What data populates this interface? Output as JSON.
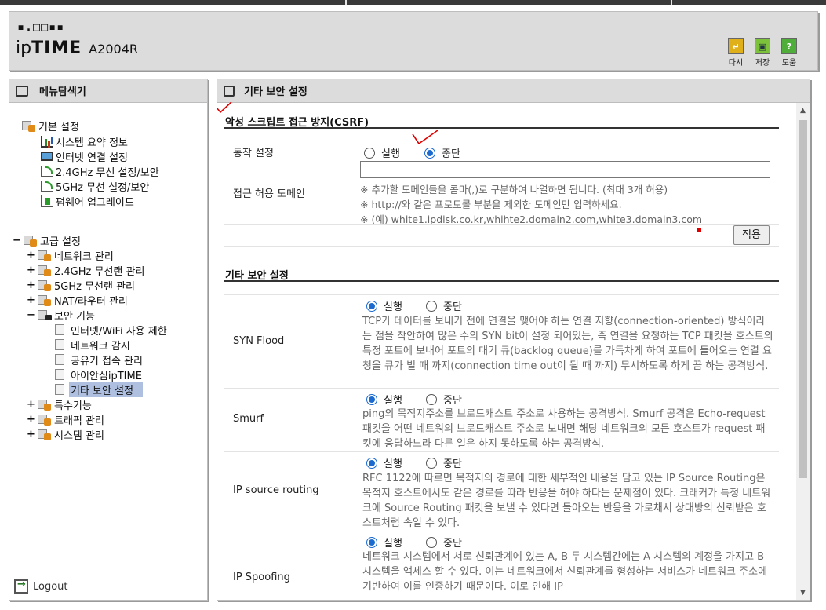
{
  "header": {
    "logo_dots": "▪.□□▪▪",
    "brand_ip": "ip",
    "brand_time": "TIME",
    "model": "A2004R",
    "buttons": [
      {
        "label": "다시",
        "icon": "undo-icon",
        "glyph": "↵"
      },
      {
        "label": "저장",
        "icon": "save-icon",
        "glyph": "▣"
      },
      {
        "label": "도움",
        "icon": "help-icon",
        "glyph": "?"
      }
    ]
  },
  "sidebar": {
    "title": "메뉴탐색기",
    "basic": {
      "label": "기본 설정",
      "items": [
        "시스템 요약 정보",
        "인터넷 연결 설정",
        "2.4GHz 무선 설정/보안",
        "5GHz 무선 설정/보안",
        "펌웨어 업그레이드"
      ]
    },
    "advanced": {
      "label": "고급 설정",
      "items": [
        "네트워크 관리",
        "2.4GHz 무선랜 관리",
        "5GHz 무선랜 관리",
        "NAT/라우터 관리",
        "보안 기능"
      ],
      "security_items": [
        "인터넷/WiFi 사용 제한",
        "네트워크 감시",
        "공유기 접속 관리",
        "아이안심ipTIME",
        "기타 보안 설정"
      ],
      "more_items": [
        "특수기능",
        "트래픽 관리",
        "시스템 관리"
      ]
    },
    "logout": "Logout"
  },
  "main": {
    "title": "기타 보안 설정",
    "csrf": {
      "title": "악성 스크립트 접근 방지(CSRF)",
      "action_label": "동작 설정",
      "run": "실행",
      "stop": "중단",
      "selected": "stop",
      "domain_label": "접근 허용 도메인",
      "domain_value": "",
      "notes": [
        "※ 추가할 도메인들을 콤마(,)로 구분하여 나열하면 됩니다. (최대 3개 허용)",
        "※ http://와 같은 프로토콜 부분을 제외한 도메인만 입력하세요.",
        "※ (예) white1.ipdisk.co.kr,whihte2.domain2.com,white3.domain3.com"
      ],
      "apply": "적용"
    },
    "other": {
      "title": "기타 보안 설정",
      "items": [
        {
          "name": "SYN Flood",
          "run": "실행",
          "stop": "중단",
          "selected": "run",
          "desc": "TCP가 데이터를 보내기 전에 연결을 맺어야 하는 연결 지향(connection-oriented) 방식이라는 점을 착안하여 많은 수의 SYN bit이 설정 되어있는, 즉 연결을 요청하는 TCP 패킷을 호스트의 특정 포트에 보내어 포트의 대기 큐(backlog queue)를 가득차게 하여 포트에 들어오는 연결 요청을 큐가 빌 때 까지(connection time out이 될 때 까지) 무시하도록 하게 끔 하는 공격방식."
        },
        {
          "name": "Smurf",
          "run": "실행",
          "stop": "중단",
          "selected": "run",
          "desc": "ping의 목적지주소를 브로드캐스트 주소로 사용하는 공격방식. Smurf 공격은 Echo-request 패킷을 어떤 네트워의 브로드캐스트 주소로 보내면 해당 네트워크의 모든 호스트가 request 패킷에 응답하느라 다른 일은 하지 못하도록 하는 공격방식."
        },
        {
          "name": "IP source routing",
          "run": "실행",
          "stop": "중단",
          "selected": "run",
          "desc": "RFC 1122에 따르면 목적지의 경로에 대한 세부적인 내용을 담고 있는 IP Source Routing은 목적지 호스트에서도 같은 경로를 따라 반응을 해야 하다는 문제점이 있다. 크래커가 특정 네트워크에 Source Routing 패킷을 보낼 수 있다면 돌아오는 반응을 가로채서 상대방의 신뢰받은 호스트처럼 속일 수 있다."
        },
        {
          "name": "IP Spoofing",
          "run": "실행",
          "stop": "중단",
          "selected": "run",
          "desc": "네트워크 시스템에서 서로 신뢰관계에 있는 A, B 두 시스템간에는 A 시스템의 계정을 가지고 B 시스템을 액세스 할 수 있다. 이는 네트워크에서 신뢰관계를 형성하는 서비스가 네트워크 주소에 기반하여 이를 인증하기 때문이다. 이로 인해 IP"
        }
      ]
    }
  }
}
